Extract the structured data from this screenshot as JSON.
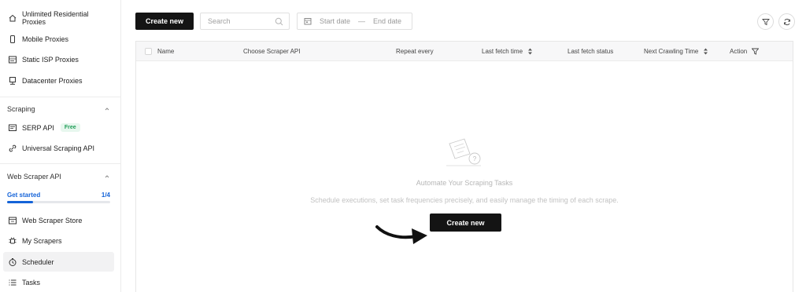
{
  "sidebar": {
    "items_top": [
      {
        "label": "Unlimited Residential Proxies",
        "icon": "home-icon"
      },
      {
        "label": "Mobile Proxies",
        "icon": "mobile-icon"
      },
      {
        "label": "Static ISP Proxies",
        "icon": "server-icon"
      },
      {
        "label": "Datacenter Proxies",
        "icon": "datacenter-icon"
      }
    ],
    "scraping": {
      "title": "Scraping",
      "items": [
        {
          "label": "SERP API",
          "icon": "serp-icon",
          "badge": "Free"
        },
        {
          "label": "Universal Scraping API",
          "icon": "link-icon"
        }
      ]
    },
    "web_scraper_api": {
      "title": "Web Scraper API",
      "progress_label": "Get started",
      "progress_count": "1/4",
      "progress_fraction": 0.25,
      "items": [
        {
          "label": "Web Scraper Store",
          "icon": "store-icon"
        },
        {
          "label": "My Scrapers",
          "icon": "spider-icon"
        },
        {
          "label": "Scheduler",
          "icon": "clock-icon",
          "active": true
        },
        {
          "label": "Tasks",
          "icon": "list-icon"
        }
      ]
    }
  },
  "toolbar": {
    "create_label": "Create new",
    "search_placeholder": "Search",
    "start_date": "Start date",
    "end_date": "End date",
    "separator": "—"
  },
  "table": {
    "columns": [
      {
        "label": "Name"
      },
      {
        "label": "Choose Scraper API"
      },
      {
        "label": "Repeat every"
      },
      {
        "label": "Last fetch time",
        "sortable": true
      },
      {
        "label": "Last fetch status"
      },
      {
        "label": "Next Crawling Time",
        "sortable": true
      },
      {
        "label": "Action",
        "filter": true
      }
    ]
  },
  "empty_state": {
    "title": "Automate Your Scraping Tasks",
    "subtitle": "Schedule executions, set task frequencies precisely, and easily manage the timing of each scrape.",
    "button_label": "Create new"
  },
  "colors": {
    "accent": "#1463d8",
    "primary_button": "#141414",
    "free_badge": "#1f9d57"
  }
}
